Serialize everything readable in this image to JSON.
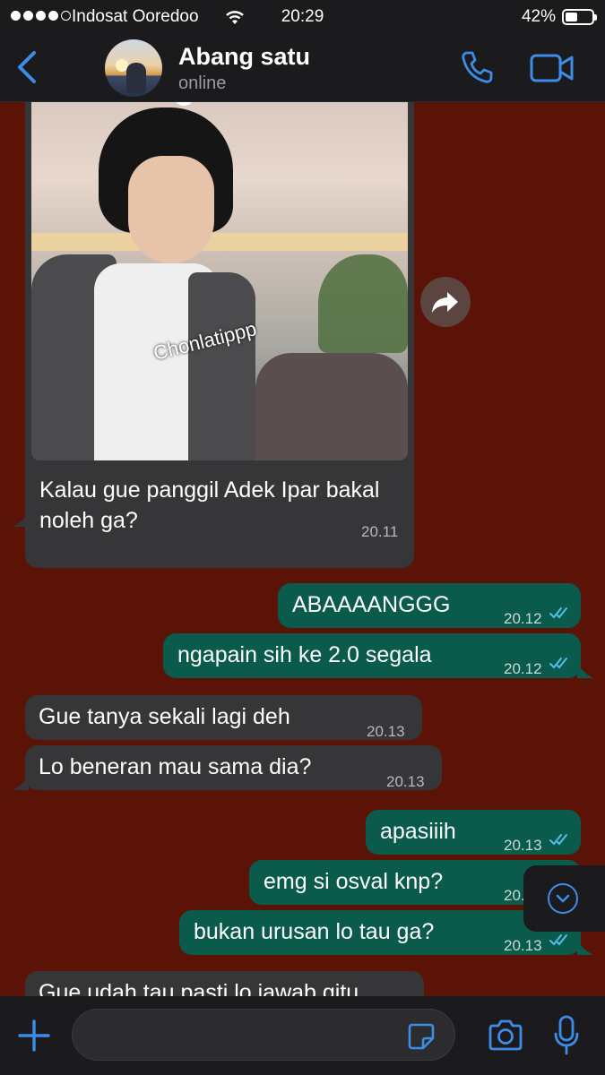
{
  "status_bar": {
    "carrier": "Indosat Ooredoo",
    "time": "20:29",
    "battery": "42%",
    "battery_level": 0.42,
    "signal_bars": 4
  },
  "header": {
    "name": "Abang satu",
    "status": "online",
    "accent_color": "#3d8ce8"
  },
  "messages": [
    {
      "direction": "in",
      "type": "image",
      "watermark": "Chonlatippp",
      "text": "Kalau gue panggil Adek Ipar bakal noleh ga?",
      "time": "20.11"
    },
    {
      "direction": "out",
      "text": "ABAAAANGGG",
      "time": "20.12",
      "status": "read"
    },
    {
      "direction": "out",
      "text": "ngapain sih ke 2.0 segala",
      "time": "20.12",
      "status": "read"
    },
    {
      "direction": "in",
      "text": "Gue tanya sekali lagi deh",
      "time": "20.13"
    },
    {
      "direction": "in",
      "text": "Lo beneran mau sama dia?",
      "time": "20.13"
    },
    {
      "direction": "out",
      "text": "apasiiih",
      "time": "20.13",
      "status": "read"
    },
    {
      "direction": "out",
      "text": "emg si osval knp?",
      "time": "20.13",
      "status": "read"
    },
    {
      "direction": "out",
      "text": "bukan urusan lo tau ga?",
      "time": "20.13",
      "status": "read"
    },
    {
      "direction": "in",
      "text": "Gue udah tau pasti lo jawab gitu",
      "time": ""
    }
  ],
  "input": {
    "value": "",
    "placeholder": ""
  },
  "colors": {
    "chat_background": "#5a1306",
    "incoming_bubble": "#363638",
    "outgoing_bubble": "#0a5b4c",
    "read_ticks": "#53bdeb"
  }
}
